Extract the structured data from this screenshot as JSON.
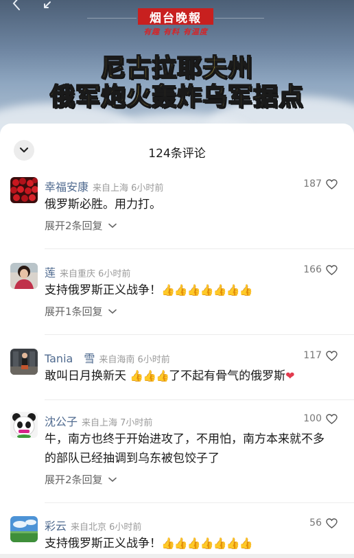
{
  "video": {
    "logo": "烟台晚報",
    "slogan": "有趣 有料 有温度",
    "headline_line1": "尼古拉耶夫州",
    "headline_line2": "俄军炮火轰炸乌军据点"
  },
  "comments_panel": {
    "title": "124条评论",
    "comments": [
      {
        "name": "幸福安康",
        "meta": "来自上海 6小时前",
        "likes": "187",
        "text": "俄罗斯必胜。用力打。",
        "expand": "展开2条回复"
      },
      {
        "name": "莲",
        "meta": "来自重庆 6小时前",
        "likes": "166",
        "text": "支持俄罗斯正义战争！",
        "thumbs": "👍👍👍👍👍👍👍",
        "expand": "展开1条回复"
      },
      {
        "name": "Tania　雪",
        "meta": "来自海南 6小时前",
        "likes": "117",
        "text_a": "敢叫日月换新天 ",
        "thumbs": "👍👍👍",
        "text_b": "了不起有骨气的俄罗斯",
        "heart": "❤"
      },
      {
        "name": "沈公子",
        "meta": "来自上海 7小时前",
        "likes": "100",
        "text": "牛，南方也终于开始进攻了，不用怕，南方本来就不多的部队已经抽调到乌东被包饺子了",
        "expand": "展开2条回复"
      },
      {
        "name": "彩云",
        "meta": "来自北京 6小时前",
        "likes": "56",
        "text": "支持俄罗斯正义战争！",
        "thumbs": "👍👍👍👍👍👍👍"
      }
    ]
  },
  "icons": {
    "collapse": "chevron-down-icon",
    "like": "heart-outline-icon",
    "expand": "chevron-down-icon"
  },
  "colors": {
    "name": "#4f6a8f",
    "headline": "#f3d54a",
    "logo_bg": "#c8201f"
  }
}
